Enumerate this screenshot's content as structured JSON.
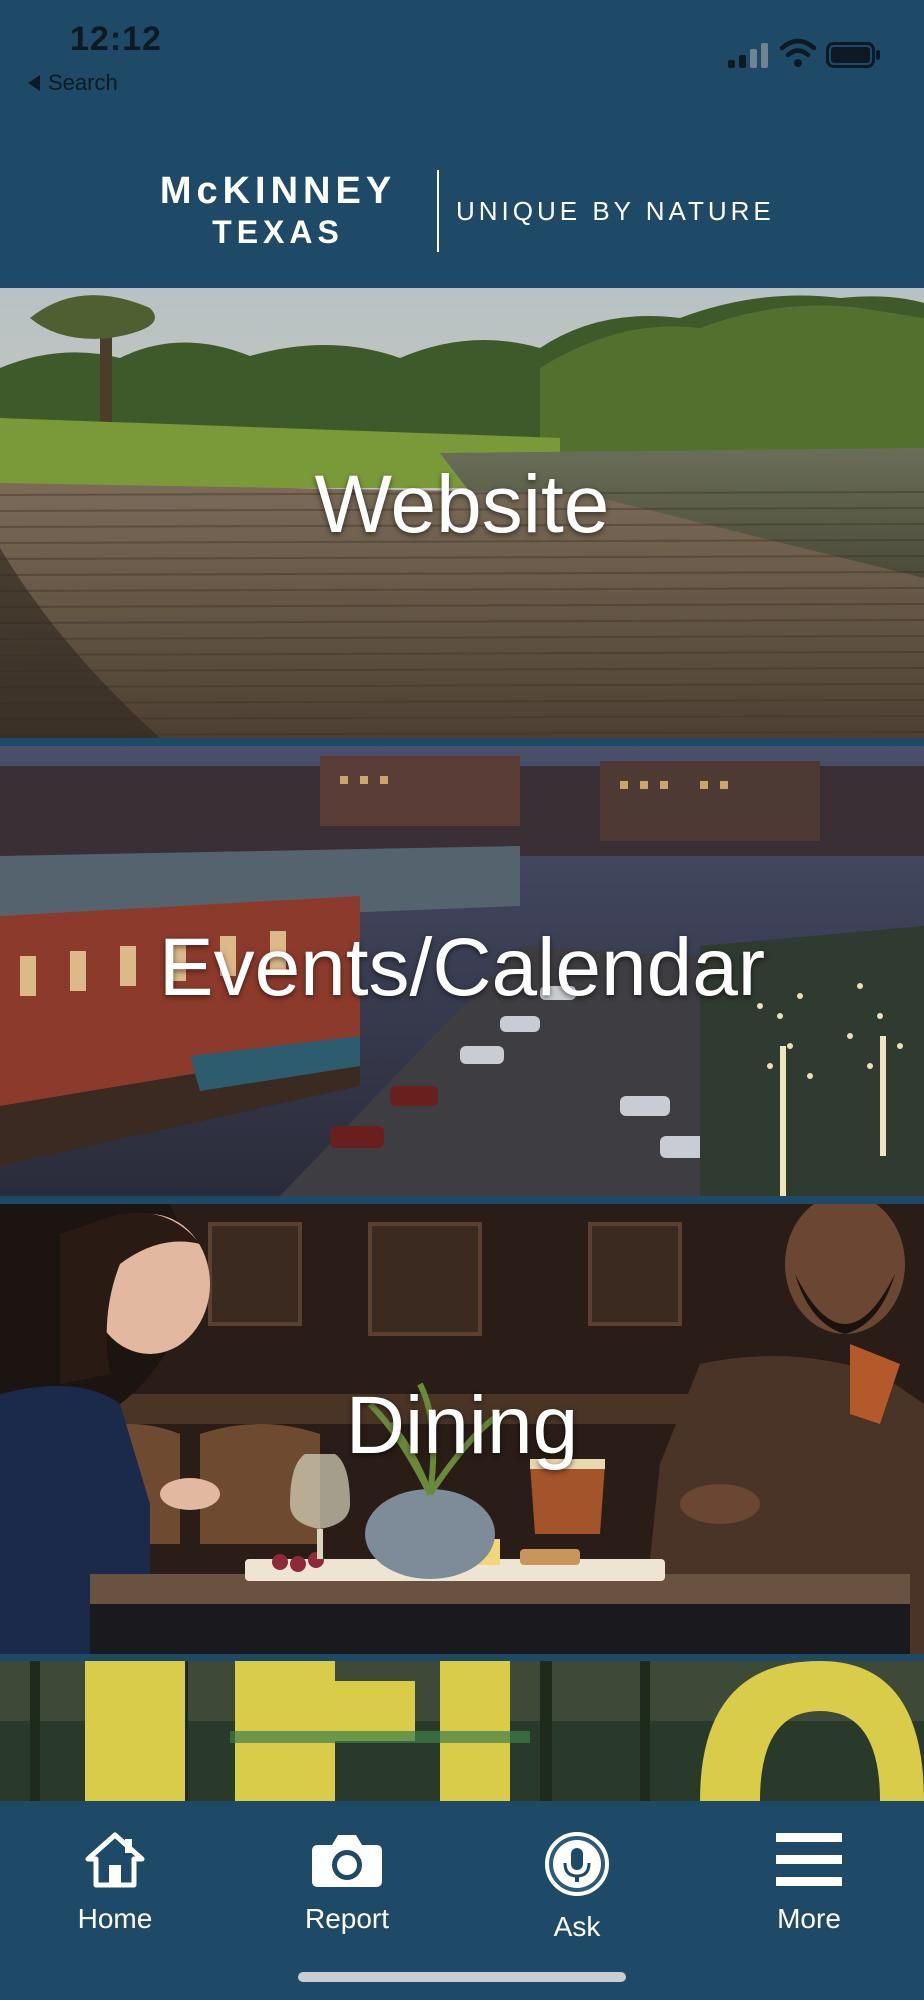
{
  "status_bar": {
    "time": "12:12",
    "back_label": "Search"
  },
  "header": {
    "logo_city": "McKINNEY",
    "logo_state": "TEXAS",
    "tagline": "UNIQUE BY NATURE"
  },
  "tiles": [
    {
      "label": "Website"
    },
    {
      "label": "Events/Calendar"
    },
    {
      "label": "Dining"
    },
    {
      "label": ""
    }
  ],
  "tab_bar": {
    "items": [
      {
        "label": "Home",
        "icon": "home-icon"
      },
      {
        "label": "Report",
        "icon": "camera-icon"
      },
      {
        "label": "Ask",
        "icon": "microphone-icon"
      },
      {
        "label": "More",
        "icon": "menu-icon"
      }
    ]
  },
  "colors": {
    "brand_navy": "#1f4a67",
    "text": "#ffffff",
    "status_text": "#0d1a24"
  }
}
